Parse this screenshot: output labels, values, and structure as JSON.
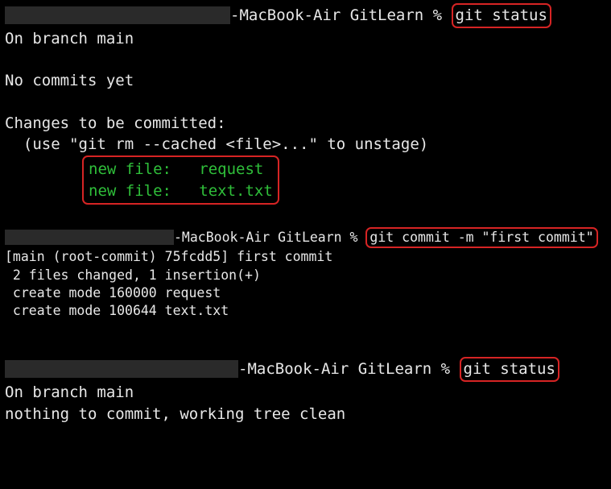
{
  "block1": {
    "host_suffix": "-MacBook-Air GitLearn % ",
    "command": "git status",
    "line1": "On branch main",
    "line2": "No commits yet",
    "line3": "Changes to be committed:",
    "line4": "  (use \"git rm --cached <file>...\" to unstage)",
    "staged1": "new file:   request",
    "staged2": "new file:   text.txt"
  },
  "block2": {
    "host_suffix": "-MacBook-Air GitLearn % ",
    "command": "git commit -m \"first commit\"",
    "out1": "[main (root-commit) 75fcdd5] first commit",
    "out2": " 2 files changed, 1 insertion(+)",
    "out3": " create mode 160000 request",
    "out4": " create mode 100644 text.txt"
  },
  "block3": {
    "host_suffix": "-MacBook-Air GitLearn % ",
    "command": "git status",
    "out1": "On branch main",
    "out2": "nothing to commit, working tree clean"
  }
}
